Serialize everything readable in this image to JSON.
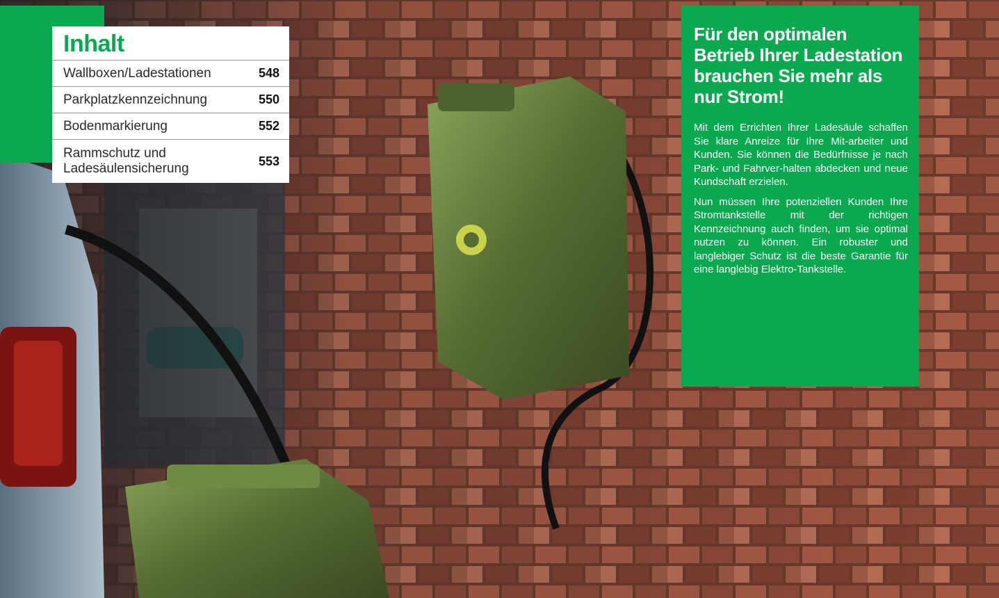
{
  "toc": {
    "title": "Inhalt",
    "items": [
      {
        "label": "Wallboxen/Ladestationen",
        "page": "548"
      },
      {
        "label": "Parkplatzkennzeichnung",
        "page": "550"
      },
      {
        "label": "Bodenmarkierung",
        "page": "552"
      },
      {
        "label": "Rammschutz und Ladesäulensicherung",
        "page": "553"
      }
    ]
  },
  "info": {
    "heading": "Für den optimalen Betrieb Ihrer Ladestation brauchen Sie mehr als nur Strom!",
    "paragraph_1": "Mit dem Errichten Ihrer Ladesäule schaffen Sie klare Anreize für Ihre Mit-arbeiter und Kunden. Sie können die Bedürfnisse je nach Park- und Fahrver-halten abdecken und neue Kundschaft erzielen.",
    "paragraph_2": "Nun müssen Ihre potenziellen Kunden Ihre Stromtankstelle mit der richtigen Kennzeichnung auch finden, um sie optimal nutzen zu können. Ein robuster und langlebiger Schutz ist die beste Garantie für eine langlebig Elektro-Tankstelle."
  },
  "colors": {
    "brand_green": "#0aa84f",
    "brick": "#8a4a38"
  },
  "photo": {
    "icons": [
      "wall-charger-jerrycan",
      "floor-jerrycan",
      "car-taillight",
      "charging-cable"
    ]
  }
}
